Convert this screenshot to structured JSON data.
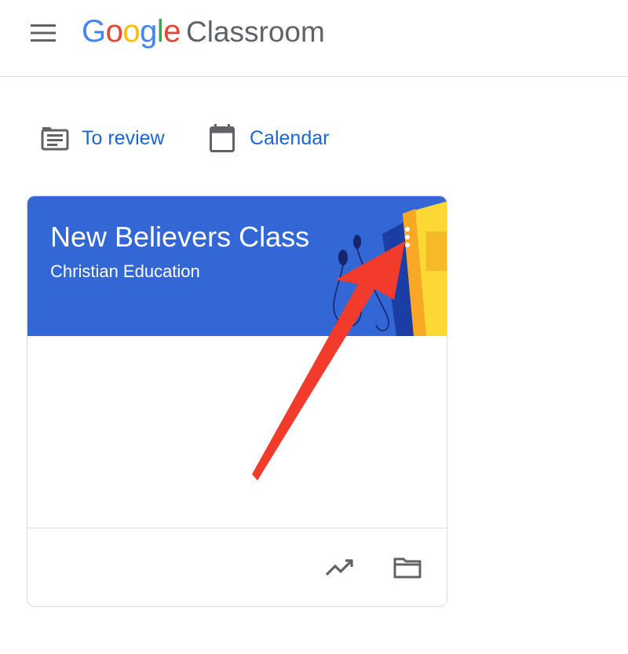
{
  "header": {
    "brand_google_letters": [
      "G",
      "o",
      "o",
      "g",
      "l",
      "e"
    ],
    "brand_product": "Classroom"
  },
  "quicklinks": {
    "to_review": "To review",
    "calendar": "Calendar"
  },
  "class_card": {
    "title": "New Believers Class",
    "section": "Christian Education"
  },
  "icons": {
    "menu": "hamburger-menu-icon",
    "to_review": "assignment-list-icon",
    "calendar": "calendar-icon",
    "more": "more-vert-icon",
    "gradebook": "trending-up-icon",
    "folder": "folder-icon"
  },
  "colors": {
    "google_blue": "#4285f4",
    "google_red": "#ea4335",
    "google_yellow": "#fbbc05",
    "google_green": "#34a853",
    "link_blue": "#1967d2",
    "card_header": "#3367d6",
    "annotation_arrow": "#f23b2b"
  }
}
